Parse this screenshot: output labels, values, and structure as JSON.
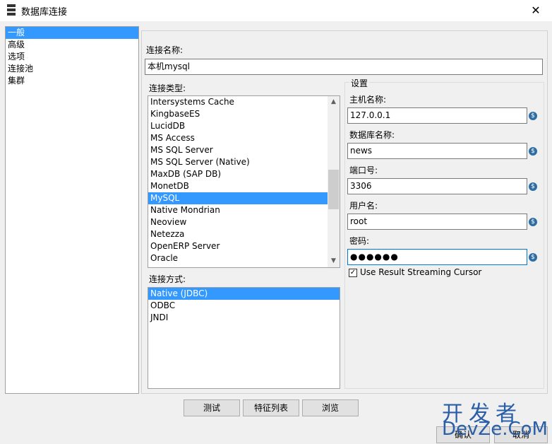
{
  "window": {
    "title": "数据库连接",
    "close_glyph": "✕"
  },
  "nav": {
    "items": [
      "一般",
      "高级",
      "选项",
      "连接池",
      "集群"
    ],
    "selected_index": 0
  },
  "general": {
    "connection_name_label": "连接名称:",
    "connection_name_value": "本机mysql",
    "connection_type_label": "连接类型:",
    "connection_types": [
      "Intersystems Cache",
      "KingbaseES",
      "LucidDB",
      "MS Access",
      "MS SQL Server",
      "MS SQL Server (Native)",
      "MaxDB (SAP DB)",
      "MonetDB",
      "MySQL",
      "Native Mondrian",
      "Neoview",
      "Netezza",
      "OpenERP Server",
      "Oracle"
    ],
    "connection_type_selected": "MySQL",
    "access_label": "连接方式:",
    "access_methods": [
      "Native (JDBC)",
      "ODBC",
      "JNDI"
    ],
    "access_selected": "Native (JDBC)"
  },
  "settings": {
    "title": "设置",
    "host_label": "主机名称:",
    "host_value": "127.0.0.1",
    "db_label": "数据库名称:",
    "db_value": "news",
    "port_label": "端口号:",
    "port_value": "3306",
    "user_label": "用户名:",
    "user_value": "root",
    "password_label": "密码:",
    "password_value": "●●●●●●",
    "streaming_label": "Use Result Streaming Cursor",
    "streaming_checked": true,
    "variable_glyph": "$"
  },
  "buttons": {
    "test": "测试",
    "features": "特征列表",
    "browse": "浏览",
    "ok": "确认",
    "cancel": "取消"
  },
  "watermark": {
    "cn": "开发者",
    "en": "DevZe.CoM"
  },
  "colors": {
    "selection": "#3399ff",
    "focus_border": "#0078d7",
    "watermark": "#2a5fa8"
  }
}
